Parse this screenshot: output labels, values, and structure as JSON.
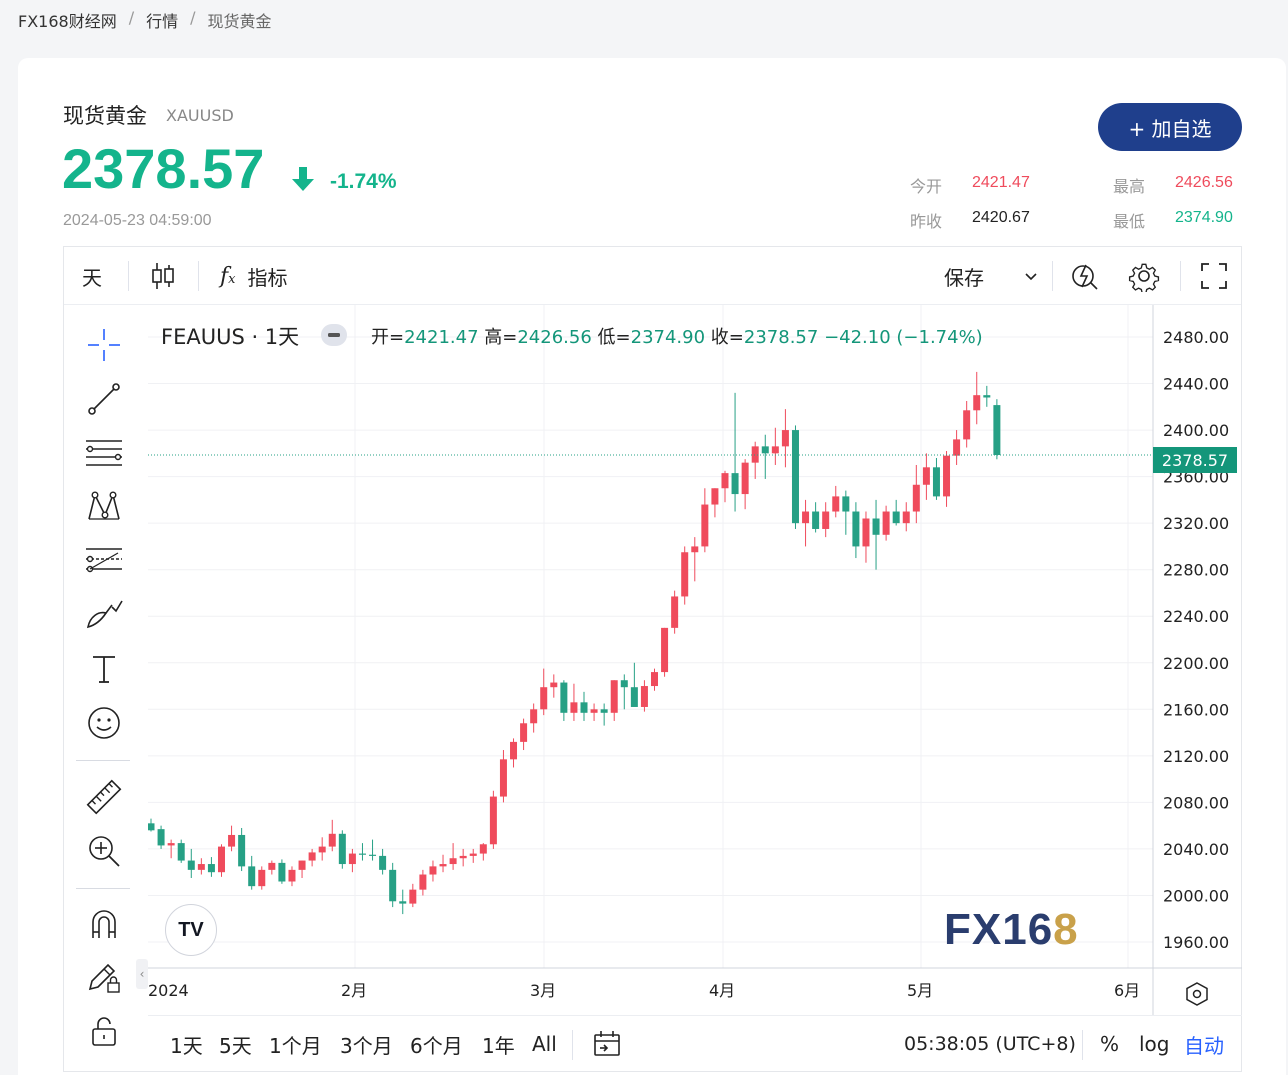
{
  "breadcrumb": {
    "home": "FX168财经网",
    "sep": "/",
    "section": "行情",
    "current": "现货黄金"
  },
  "quote": {
    "name": "现货黄金",
    "code": "XAUUSD",
    "price": "2378.57",
    "change_pct": "-1.74%",
    "timestamp": "2024-05-23 04:59:00",
    "direction": "down"
  },
  "add_button": "+ 加自选",
  "stats": {
    "open_label": "今开",
    "open": "2421.47",
    "high_label": "最高",
    "high": "2426.56",
    "prev_label": "昨收",
    "prev": "2420.67",
    "low_label": "最低",
    "low": "2374.90"
  },
  "toolbar": {
    "interval": "天",
    "indicators": "指标",
    "save": "保存"
  },
  "legend": {
    "symbol": "FEAUUS · 1天",
    "o_label": "开=",
    "o": "2421.47",
    "h_label": "高=",
    "h": "2426.56",
    "l_label": "低=",
    "l": "2374.90",
    "c_label": "收=",
    "c": "2378.57",
    "chg": "−42.10 (−1.74%)"
  },
  "last_price_tag": "2378.57",
  "watermark": {
    "left": "FX16",
    "right": "8"
  },
  "tv_logo": "TV",
  "bottom": {
    "ranges": [
      "1天",
      "5天",
      "1个月",
      "3个月",
      "6个月",
      "1年",
      "All"
    ],
    "clock": "05:38:05 (UTC+8)",
    "percent": "%",
    "log": "log",
    "auto": "自动"
  },
  "colors": {
    "up": "#ef4b5c",
    "down": "#26a085",
    "accent": "#14b48c",
    "brand": "#1f3f8c"
  },
  "chart_data": {
    "type": "candlestick",
    "title": "",
    "x_tick_labels": [
      "2024",
      "2月",
      "3月",
      "4月",
      "5月",
      "6月"
    ],
    "y_tick_labels": [
      "2480.00",
      "2440.00",
      "2400.00",
      "2360.00",
      "2320.00",
      "2280.00",
      "2240.00",
      "2200.00",
      "2160.00",
      "2120.00",
      "2080.00",
      "2040.00",
      "2000.00",
      "1960.00"
    ],
    "ylim": [
      1950,
      2500
    ],
    "last_close": 2378.57,
    "candles": [
      [
        2062,
        2066,
        2055,
        2056
      ],
      [
        2057,
        2060,
        2040,
        2043
      ],
      [
        2043,
        2048,
        2032,
        2045
      ],
      [
        2045,
        2048,
        2028,
        2030
      ],
      [
        2030,
        2040,
        2015,
        2022
      ],
      [
        2022,
        2032,
        2018,
        2027
      ],
      [
        2027,
        2033,
        2016,
        2020
      ],
      [
        2020,
        2044,
        2016,
        2042
      ],
      [
        2042,
        2060,
        2038,
        2052
      ],
      [
        2052,
        2058,
        2021,
        2025
      ],
      [
        2025,
        2034,
        2005,
        2008
      ],
      [
        2008,
        2025,
        2005,
        2022
      ],
      [
        2022,
        2030,
        2018,
        2028
      ],
      [
        2028,
        2031,
        2010,
        2012
      ],
      [
        2012,
        2025,
        2008,
        2022
      ],
      [
        2022,
        2030,
        2015,
        2030
      ],
      [
        2030,
        2040,
        2025,
        2037
      ],
      [
        2037,
        2050,
        2030,
        2042
      ],
      [
        2042,
        2065,
        2038,
        2053
      ],
      [
        2053,
        2056,
        2023,
        2027
      ],
      [
        2027,
        2040,
        2020,
        2036
      ],
      [
        2036,
        2045,
        2030,
        2035
      ],
      [
        2035,
        2048,
        2030,
        2034
      ],
      [
        2034,
        2040,
        2018,
        2022
      ],
      [
        2022,
        2028,
        1990,
        1995
      ],
      [
        1995,
        2005,
        1984,
        1993
      ],
      [
        1993,
        2010,
        1990,
        2005
      ],
      [
        2005,
        2022,
        2000,
        2018
      ],
      [
        2018,
        2030,
        2012,
        2025
      ],
      [
        2025,
        2035,
        2020,
        2027
      ],
      [
        2027,
        2045,
        2022,
        2032
      ],
      [
        2032,
        2040,
        2025,
        2034
      ],
      [
        2034,
        2040,
        2028,
        2036
      ],
      [
        2036,
        2045,
        2030,
        2044
      ],
      [
        2044,
        2090,
        2040,
        2085
      ],
      [
        2085,
        2125,
        2080,
        2117
      ],
      [
        2117,
        2135,
        2110,
        2132
      ],
      [
        2132,
        2152,
        2125,
        2148
      ],
      [
        2148,
        2165,
        2140,
        2160
      ],
      [
        2160,
        2195,
        2155,
        2179
      ],
      [
        2179,
        2190,
        2170,
        2183
      ],
      [
        2183,
        2185,
        2150,
        2157
      ],
      [
        2157,
        2182,
        2150,
        2166
      ],
      [
        2166,
        2175,
        2150,
        2157
      ],
      [
        2157,
        2165,
        2150,
        2160
      ],
      [
        2160,
        2165,
        2146,
        2157
      ],
      [
        2157,
        2185,
        2150,
        2185
      ],
      [
        2185,
        2190,
        2160,
        2179
      ],
      [
        2179,
        2200,
        2165,
        2162
      ],
      [
        2162,
        2185,
        2158,
        2180
      ],
      [
        2180,
        2195,
        2176,
        2192
      ],
      [
        2192,
        2230,
        2188,
        2230
      ],
      [
        2230,
        2262,
        2225,
        2257
      ],
      [
        2257,
        2300,
        2250,
        2295
      ],
      [
        2295,
        2308,
        2270,
        2300
      ],
      [
        2300,
        2350,
        2295,
        2336
      ],
      [
        2336,
        2350,
        2325,
        2350
      ],
      [
        2350,
        2365,
        2338,
        2363
      ],
      [
        2363,
        2432,
        2330,
        2345
      ],
      [
        2345,
        2375,
        2332,
        2372
      ],
      [
        2372,
        2390,
        2358,
        2386
      ],
      [
        2386,
        2396,
        2358,
        2380
      ],
      [
        2380,
        2402,
        2370,
        2386
      ],
      [
        2386,
        2418,
        2368,
        2400
      ],
      [
        2400,
        2404,
        2315,
        2320
      ],
      [
        2320,
        2340,
        2300,
        2330
      ],
      [
        2330,
        2338,
        2312,
        2315
      ],
      [
        2315,
        2338,
        2308,
        2330
      ],
      [
        2330,
        2352,
        2325,
        2343
      ],
      [
        2343,
        2348,
        2310,
        2330
      ],
      [
        2330,
        2338,
        2290,
        2300
      ],
      [
        2300,
        2330,
        2286,
        2324
      ],
      [
        2324,
        2340,
        2280,
        2310
      ],
      [
        2310,
        2335,
        2305,
        2330
      ],
      [
        2330,
        2340,
        2318,
        2320
      ],
      [
        2320,
        2338,
        2313,
        2330
      ],
      [
        2330,
        2370,
        2320,
        2353
      ],
      [
        2353,
        2380,
        2340,
        2368
      ],
      [
        2368,
        2376,
        2340,
        2343
      ],
      [
        2343,
        2382,
        2334,
        2378
      ],
      [
        2378,
        2400,
        2370,
        2392
      ],
      [
        2392,
        2425,
        2385,
        2417
      ],
      [
        2417,
        2450,
        2405,
        2430
      ],
      [
        2430,
        2438,
        2420,
        2428
      ],
      [
        2421.47,
        2426.56,
        2374.9,
        2378.57
      ]
    ]
  }
}
